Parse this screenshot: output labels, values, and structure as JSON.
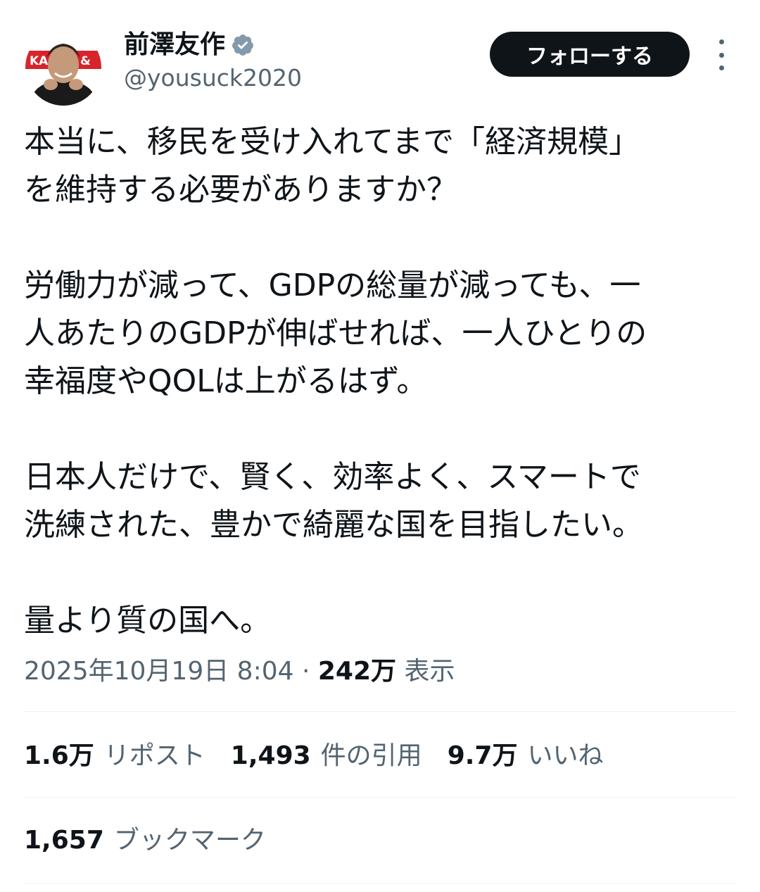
{
  "author": {
    "display_name": "前澤友作",
    "handle": "@yousuck2020",
    "verified_icon": "verified-badge-icon",
    "verified_color": "#829aab"
  },
  "header": {
    "follow_label": "フォローする",
    "more_icon": "more-vertical-icon"
  },
  "tweet": {
    "paragraphs": [
      "本当に、移民を受け入れてまで「経済規模」\nを維持する必要がありますか？",
      "労働力が減って、GDPの総量が減っても、一\n人あたりのGDPが伸ばせれば、一人ひとりの\n幸福度やQOLは上がるはず。",
      "日本人だけで、賢く、効率よく、スマートで\n洗練された、豊かで綺麗な国を目指したい。",
      "量より質の国へ。"
    ]
  },
  "meta": {
    "timestamp": "2025年10月19日 8:04",
    "separator": " · ",
    "views_count": "242万",
    "views_label": "表示"
  },
  "stats": {
    "reposts": {
      "count": "1.6万",
      "label": "リポスト"
    },
    "quotes": {
      "count": "1,493",
      "label": "件の引用"
    },
    "likes": {
      "count": "9.7万",
      "label": "いいね"
    },
    "bookmarks": {
      "count": "1,657",
      "label": "ブックマーク"
    }
  },
  "colors": {
    "text": "#0f1419",
    "secondary": "#536471",
    "divider": "#eff3f4",
    "button_bg": "#0f1419"
  }
}
